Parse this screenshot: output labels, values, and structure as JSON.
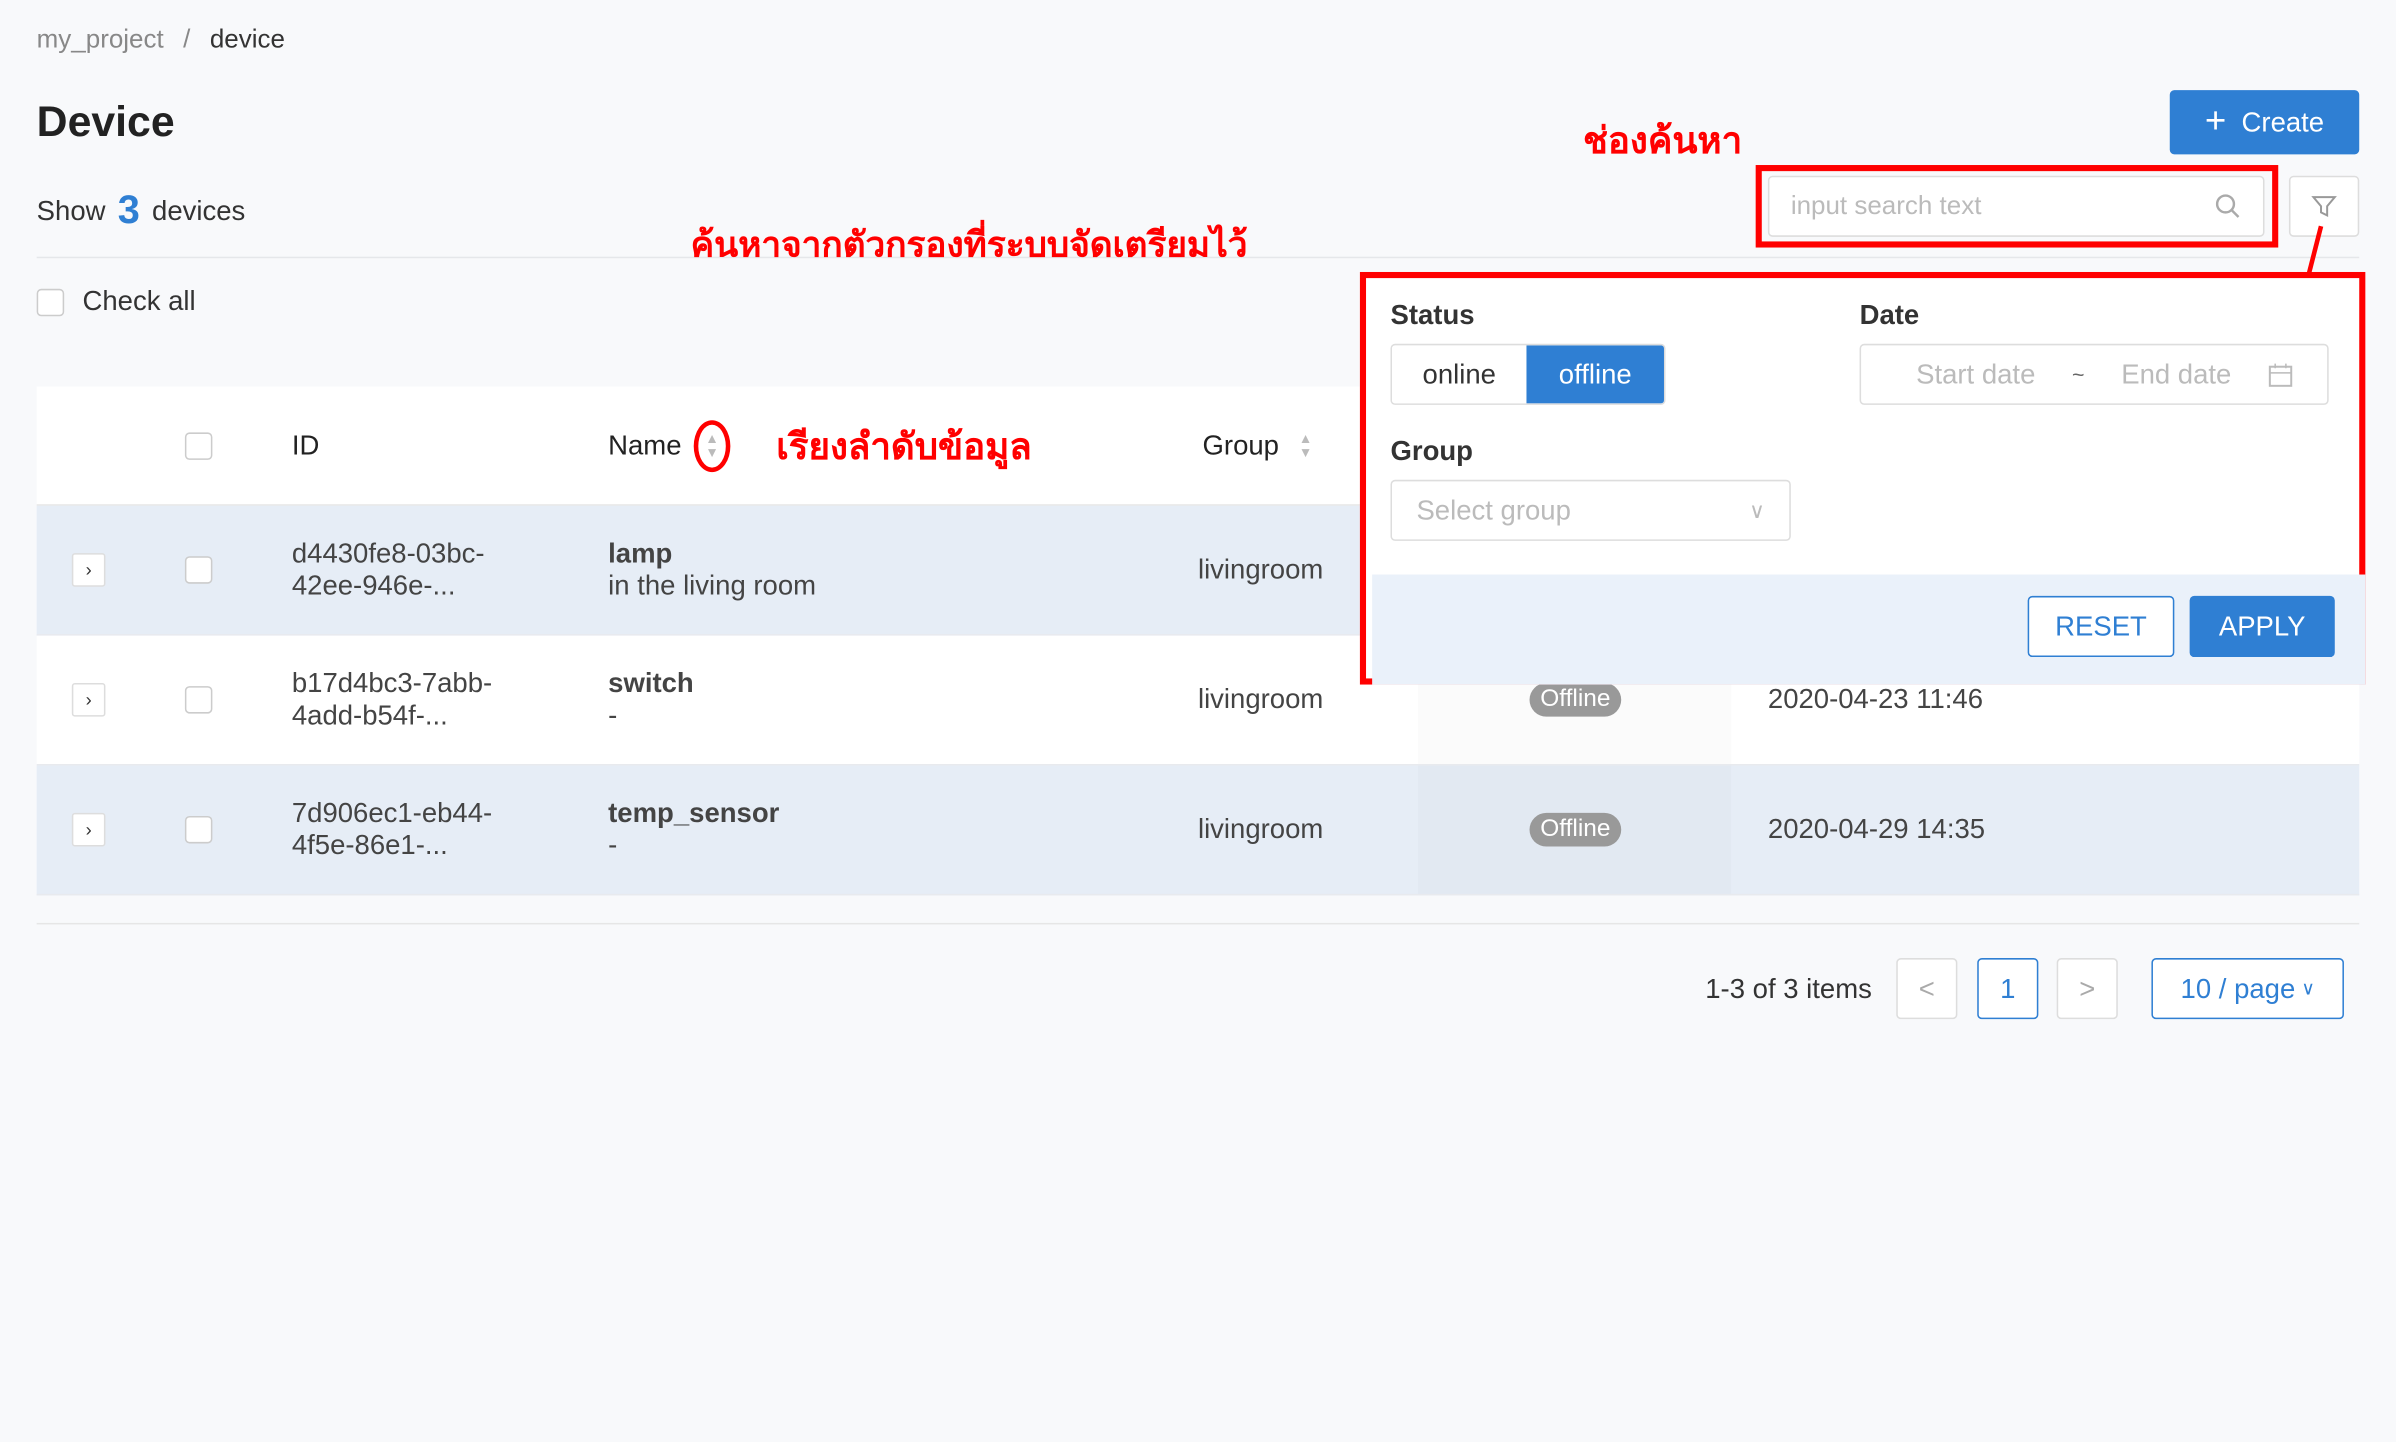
{
  "breadcrumb": {
    "project": "my_project",
    "separator": "/",
    "current": "device"
  },
  "page": {
    "title": "Device",
    "show_prefix": "Show",
    "count": "3",
    "show_suffix": "devices"
  },
  "toolbar": {
    "create_label": "Create",
    "search_placeholder": "input search text"
  },
  "check_all": "Check all",
  "table": {
    "headers": {
      "id": "ID",
      "name": "Name",
      "group": "Group"
    },
    "rows": [
      {
        "id_line1": "d4430fe8-03bc-",
        "id_line2": "42ee-946e-...",
        "name": "lamp",
        "desc": "in the living room",
        "group": "livingroom",
        "status": "",
        "date": ""
      },
      {
        "id_line1": "b17d4bc3-7abb-",
        "id_line2": "4add-b54f-...",
        "name": "switch",
        "desc": "-",
        "group": "livingroom",
        "status": "Offline",
        "date": "2020-04-23 11:46"
      },
      {
        "id_line1": "7d906ec1-eb44-",
        "id_line2": "4f5e-86e1-...",
        "name": "temp_sensor",
        "desc": "-",
        "group": "livingroom",
        "status": "Offline",
        "date": "2020-04-29 14:35"
      }
    ]
  },
  "pagination": {
    "summary": "1-3 of 3 items",
    "prev": "<",
    "page": "1",
    "next": ">",
    "page_size": "10 / page"
  },
  "filter": {
    "status_label": "Status",
    "status_options": [
      "online",
      "offline"
    ],
    "status_selected": "offline",
    "date_label": "Date",
    "start_placeholder": "Start date",
    "date_sep": "~",
    "end_placeholder": "End date",
    "group_label": "Group",
    "group_placeholder": "Select group",
    "reset": "RESET",
    "apply": "APPLY"
  },
  "annotations": {
    "search": "ช่องค้นหา",
    "filter": "ค้นหาจากตัวกรองที่ระบบจัดเตรียมไว้",
    "sort": "เรียงลำดับข้อมูล"
  },
  "colors": {
    "accent": "#2f7fd3",
    "annotation": "#ff0000",
    "row_alt": "#e6edf6",
    "badge": "#999999"
  }
}
